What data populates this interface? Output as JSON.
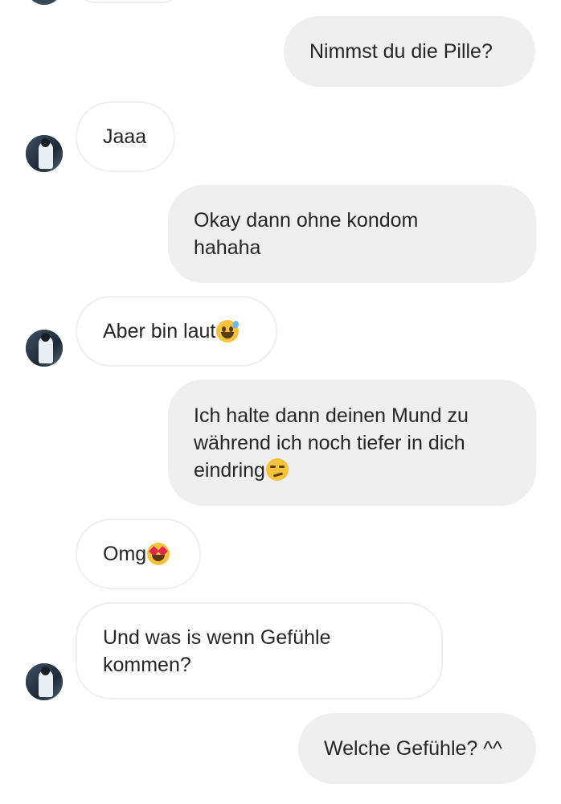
{
  "conversation": {
    "messages": [
      {
        "id": "m1",
        "direction": "outgoing",
        "text": "Nimmst du die Pille?"
      },
      {
        "id": "m2",
        "direction": "incoming",
        "text": "Jaaa"
      },
      {
        "id": "m3",
        "direction": "outgoing",
        "text": "Okay dann ohne kondom\nhahaha"
      },
      {
        "id": "m4",
        "direction": "incoming",
        "text": "Aber bin laut",
        "emoji": "grinning-sweat-emoji"
      },
      {
        "id": "m5",
        "direction": "outgoing",
        "text": "Ich halte dann deinen Mund zu\nwährend ich noch tiefer in dich\neindring",
        "emoji": "smirking-face-emoji"
      },
      {
        "id": "m6",
        "direction": "incoming",
        "text": "Omg",
        "emoji": "heart-eyes-emoji"
      },
      {
        "id": "m7",
        "direction": "incoming",
        "text": "Und was is wenn Gefühle\nkommen?"
      },
      {
        "id": "m8",
        "direction": "outgoing",
        "text": "Welche Gefühle? ^^"
      }
    ]
  },
  "colors": {
    "outgoing_bubble": "#efefef",
    "incoming_border": "#efefef",
    "text": "#262626",
    "background": "#ffffff"
  }
}
